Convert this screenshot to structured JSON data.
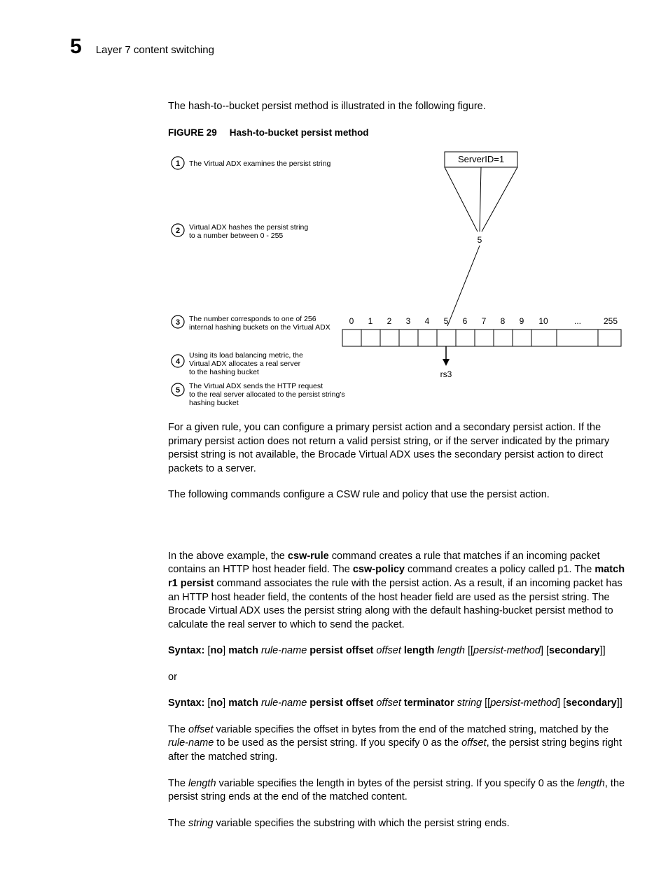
{
  "header": {
    "chapter_number": "5",
    "chapter_title": "Layer 7 content switching"
  },
  "intro": "The hash-to--bucket persist method is illustrated in the following figure.",
  "figure": {
    "label": "FIGURE 29",
    "caption": "Hash-to-bucket persist method",
    "steps": {
      "1": "The Virtual ADX examines the persist string",
      "2a": "Virtual ADX hashes the persist string",
      "2b": "to a number between 0 - 255",
      "3a": "The number corresponds to one of 256",
      "3b": "internal hashing buckets on the Virtual ADX",
      "4a": "Using its load balancing metric, the",
      "4b": "Virtual ADX allocates a real server",
      "4c": "to the hashing bucket",
      "5a": "The Virtual ADX sends the HTTP request",
      "5b": "to the real server allocated to the persist string's",
      "5c": "hashing bucket"
    },
    "server_label": "ServerID=1",
    "hash_value": "5",
    "bucket_labels": [
      "0",
      "1",
      "2",
      "3",
      "4",
      "5",
      "6",
      "7",
      "8",
      "9",
      "10",
      "...",
      "255"
    ],
    "result_server": "rs3"
  },
  "paragraphs": {
    "p1": "For a given rule, you can configure a primary persist action and a secondary persist action. If the primary persist action does not return a valid persist string, or if the server indicated by the primary persist string is not available, the Brocade Virtual ADX uses the secondary persist action to direct packets to a server.",
    "p2": "The following commands configure a CSW rule and policy that use the persist action.",
    "p3a": "In the above example, the ",
    "p3b": "csw-rule",
    "p3c": " command creates a rule that matches if an incoming packet contains an HTTP host header field. The ",
    "p3d": "csw-policy",
    "p3e": " command creates a policy called p1. The ",
    "p3f": "match r1 persist",
    "p3g": " command associates the rule with the persist action. As a result, if an incoming packet has an HTTP host header field, the contents of the host header field are used as the persist string. The Brocade Virtual ADX uses the persist string along with the default hashing-bucket persist method to calculate the real server to which to send the packet.",
    "syntax1": {
      "prefix": "Syntax:  ",
      "no": "no",
      "match": "match",
      "rulename": "rule-name",
      "persist_offset": "persist offset",
      "offset": "offset",
      "length_kw": "length",
      "length": "length",
      "persist_method": "persist-method",
      "secondary": "secondary"
    },
    "or": "or",
    "syntax2": {
      "prefix": "Syntax:  ",
      "no": "no",
      "match": "match",
      "rulename": "rule-name",
      "persist_offset": "persist offset",
      "offset": "offset",
      "terminator": "terminator",
      "string": "string",
      "persist_method": "persist-method",
      "secondary": "secondary"
    },
    "p4a": "The ",
    "p4b": "offset",
    "p4c": " variable specifies the offset in bytes from the end of the matched string, matched by the ",
    "p4d": "rule-name",
    "p4e": " to be used as the persist string. If you specify 0 as the ",
    "p4f": "offset",
    "p4g": ", the persist string begins right after the matched string.",
    "p5a": "The ",
    "p5b": "length",
    "p5c": " variable specifies the length in bytes of the persist string. If you specify 0 as the ",
    "p5d": "length",
    "p5e": ", the persist string ends at the end of the matched content.",
    "p6a": "The ",
    "p6b": "string",
    "p6c": " variable specifies the substring with which the persist string ends."
  }
}
